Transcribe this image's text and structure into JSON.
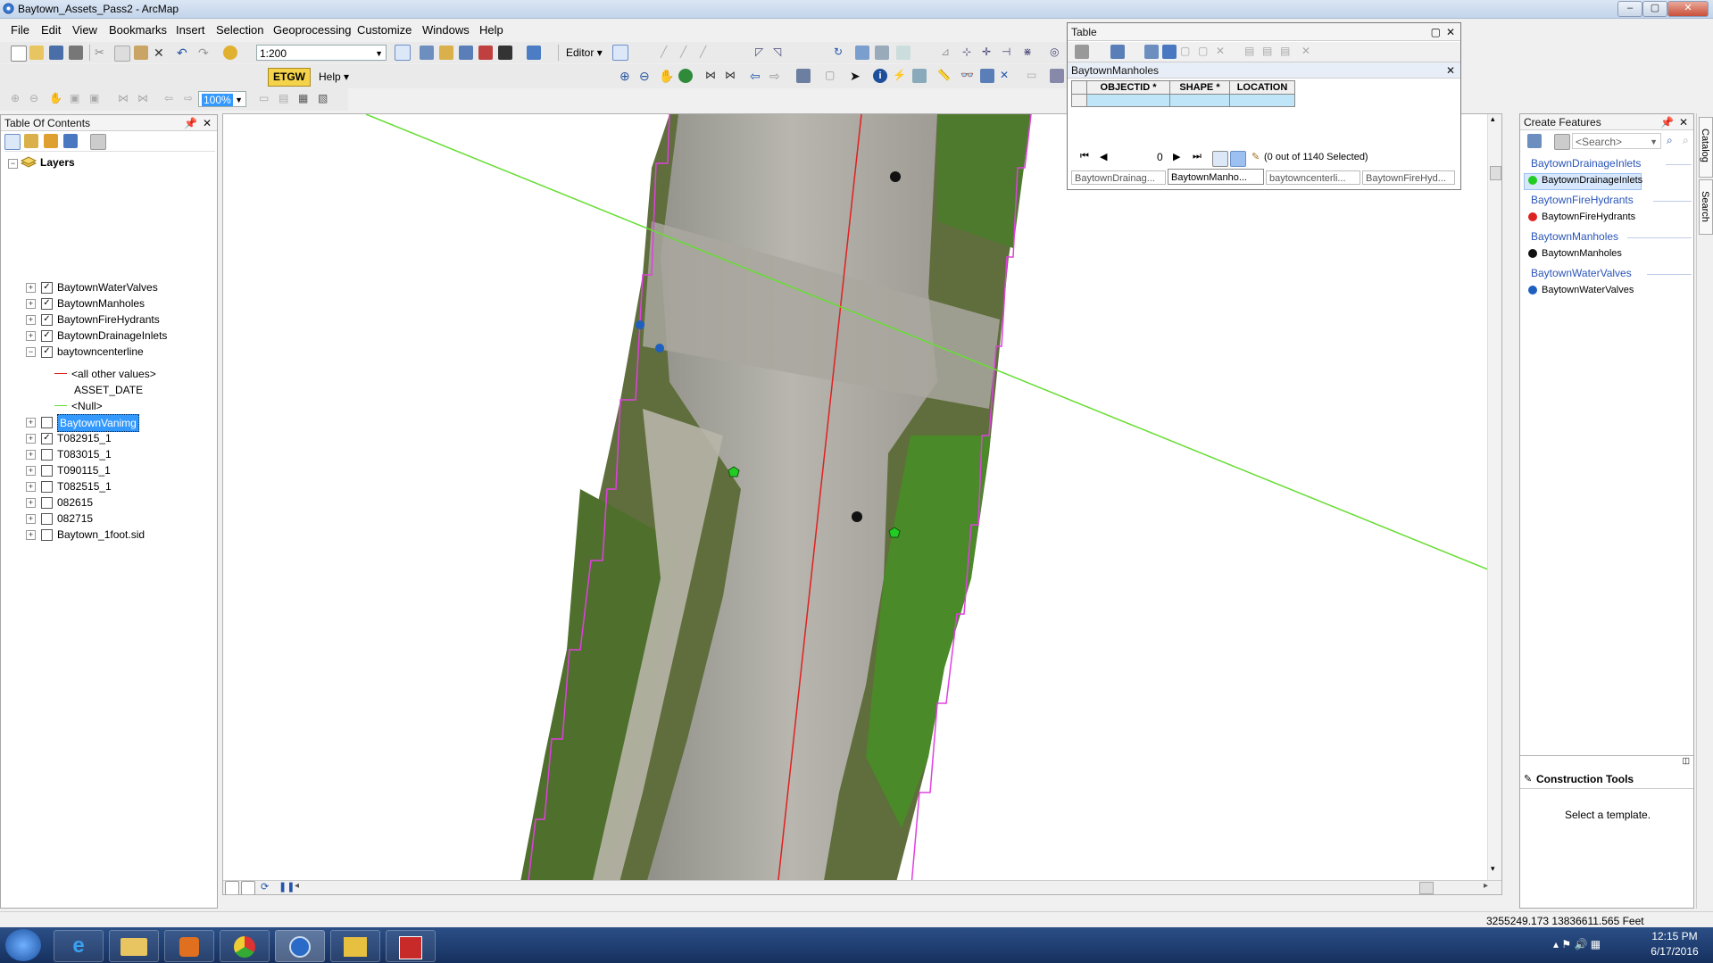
{
  "app": {
    "title": "Baytown_Assets_Pass2 - ArcMap",
    "window_buttons": [
      "–",
      "▢",
      "✕"
    ]
  },
  "menubar": [
    "File",
    "Edit",
    "View",
    "Bookmarks",
    "Insert",
    "Selection",
    "Geoprocessing",
    "Customize",
    "Windows",
    "Help"
  ],
  "toolbar": {
    "scale": "1:200",
    "editor_label": "Editor",
    "etgw_label": "ETGW",
    "help_label": "Help",
    "zoom_value": "100%"
  },
  "toc": {
    "title": "Table Of Contents",
    "root": "Layers",
    "layers": [
      {
        "name": "BaytownWaterValves",
        "checked": true,
        "expanded": false
      },
      {
        "name": "BaytownManholes",
        "checked": true,
        "expanded": false
      },
      {
        "name": "BaytownFireHydrants",
        "checked": true,
        "expanded": false
      },
      {
        "name": "BaytownDrainageInlets",
        "checked": true,
        "expanded": false
      },
      {
        "name": "baytowncenterline",
        "checked": true,
        "expanded": true
      },
      {
        "name": "BaytownVanimg",
        "checked": false,
        "expanded": false,
        "selected": true
      },
      {
        "name": "T082915_1",
        "checked": true,
        "expanded": false
      },
      {
        "name": "T083015_1",
        "checked": false,
        "expanded": false
      },
      {
        "name": "T090115_1",
        "checked": false,
        "expanded": false
      },
      {
        "name": "T082515_1",
        "checked": false,
        "expanded": false
      },
      {
        "name": "082615",
        "checked": false,
        "expanded": false
      },
      {
        "name": "082715",
        "checked": false,
        "expanded": false
      },
      {
        "name": "Baytown_1foot.sid",
        "checked": false,
        "expanded": false
      }
    ],
    "centerline_legend": {
      "all_other": "<all other values>",
      "field": "ASSET_DATE",
      "null": "<Null>"
    }
  },
  "table": {
    "window_title": "Table",
    "layer_title": "BaytownManholes",
    "columns": [
      "OBJECTID *",
      "SHAPE *",
      "LOCATION"
    ],
    "record": "0",
    "selection_status": "(0 out of 1140 Selected)",
    "tabs": [
      "BaytownDrainag...",
      "BaytownManho...",
      "baytowncenterli...",
      "BaytownFireHyd..."
    ],
    "active_tab": 1
  },
  "create_features": {
    "title": "Create Features",
    "search_placeholder": "<Search>",
    "groups": [
      {
        "group": "BaytownDrainageInlets",
        "item": "BaytownDrainageInlets",
        "color": "#22cc22",
        "selected": true
      },
      {
        "group": "BaytownFireHydrants",
        "item": "BaytownFireHydrants",
        "color": "#dd2222"
      },
      {
        "group": "BaytownManholes",
        "item": "BaytownManholes",
        "color": "#111111"
      },
      {
        "group": "BaytownWaterValves",
        "item": "BaytownWaterValves",
        "color": "#1f5fbf"
      }
    ],
    "construction_tools_title": "Construction Tools",
    "construction_message": "Select a template."
  },
  "side_tabs": [
    "Catalog",
    "Search"
  ],
  "status": {
    "coordinates": "3255249.173  13836611.565 Feet"
  },
  "clock": {
    "time": "12:15 PM",
    "date": "6/17/2016"
  },
  "colors": {
    "centerline": "#e02020",
    "null_line": "#66dd33",
    "tile_outline": "#e040e0",
    "manhole": "#111111",
    "drainage_inlet": "#22cc22",
    "water_valve": "#1f5fbf",
    "selection_highlight": "#3399ff"
  }
}
